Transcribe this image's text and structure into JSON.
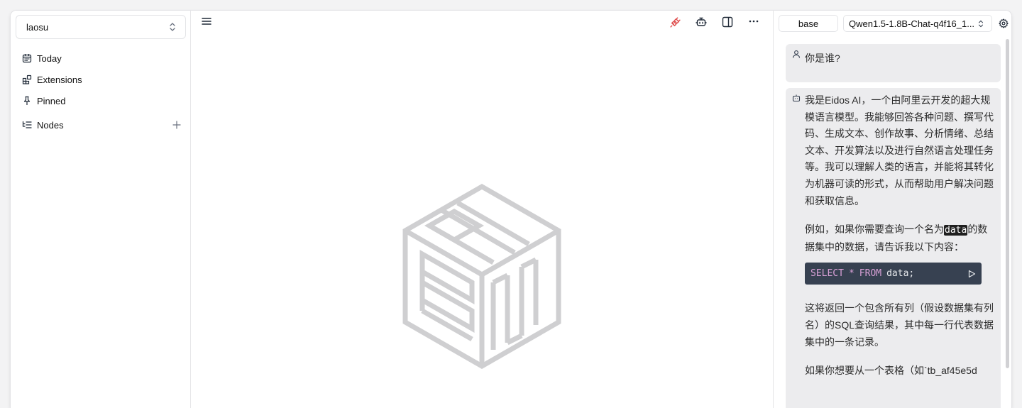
{
  "sidebar": {
    "space": "laosu",
    "items": [
      {
        "label": "Today",
        "icon": "calendar-icon"
      },
      {
        "label": "Extensions",
        "icon": "blocks-icon"
      },
      {
        "label": "Pinned",
        "icon": "pin-icon"
      },
      {
        "label": "Nodes",
        "icon": "list-tree-icon"
      }
    ]
  },
  "toolbar": {
    "icons": [
      "menu-icon",
      "unplug-icon",
      "bot-icon",
      "panel-right-icon",
      "more-horizontal-icon"
    ],
    "accent": "#e05252"
  },
  "chat": {
    "mode": "base",
    "model": "Qwen1.5-1.8B-Chat-q4f16_1...",
    "messages": {
      "user": "你是谁?",
      "bot_p1": "我是Eidos AI，一个由阿里云开发的超大规模语言模型。我能够回答各种问题、撰写代码、生成文本、创作故事、分析情绪、总结文本、开发算法以及进行自然语言处理任务等。我可以理解人类的语言，并能将其转化为机器可读的形式，从而帮助用户解决问题和获取信息。",
      "bot_p2_before": "例如，如果你需要查询一个名为",
      "bot_p2_highlight": "data",
      "bot_p2_after": "的数据集中的数据，请告诉我以下内容：",
      "code_select": "SELECT",
      "code_star": "*",
      "code_from": "FROM",
      "code_rest": "data;",
      "bot_p3": "这将返回一个包含所有列（假设数据集有列名）的SQL查询结果，其中每一行代表数据集中的一条记录。",
      "bot_p4": "如果你想要从一个表格（如`tb_af45e5d"
    }
  }
}
